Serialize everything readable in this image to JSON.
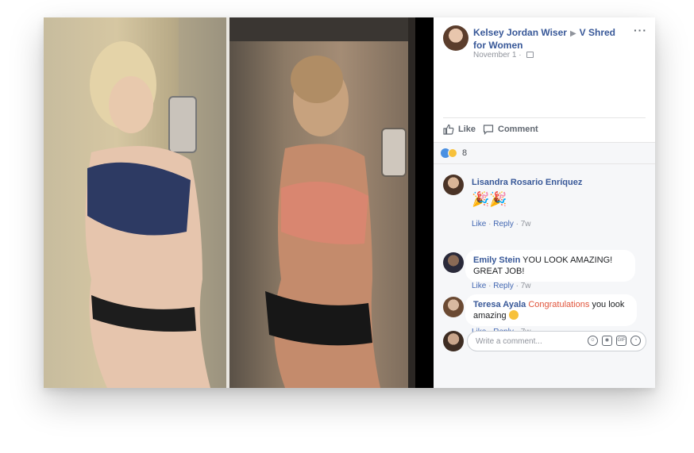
{
  "post": {
    "author": "Kelsey Jordan Wiser",
    "target_group": "V Shred for Women",
    "date": "November 1",
    "more_label": "···"
  },
  "actions": {
    "like_label": "Like",
    "comment_label": "Comment"
  },
  "reactions": {
    "count": "8"
  },
  "comments": [
    {
      "author": "Lisandra Rosario Enríquez",
      "text": "",
      "sticker": "🎉🎉",
      "like": "Like",
      "reply": "Reply",
      "time": "7w"
    },
    {
      "author": "Emily Stein",
      "text": "YOU LOOK AMAZING! GREAT JOB!",
      "like": "Like",
      "reply": "Reply",
      "time": "7w"
    },
    {
      "author": "Teresa Ayala",
      "highlight": "Congratulations",
      "text": "you look amazing",
      "like": "Like",
      "reply": "Reply",
      "time": "7w"
    }
  ],
  "composer": {
    "placeholder": "Write a comment..."
  },
  "colors": {
    "link_blue": "#385898",
    "meta_gray": "#90949c",
    "highlight_red": "#e0533a",
    "panel_bg": "#f6f7f9"
  }
}
